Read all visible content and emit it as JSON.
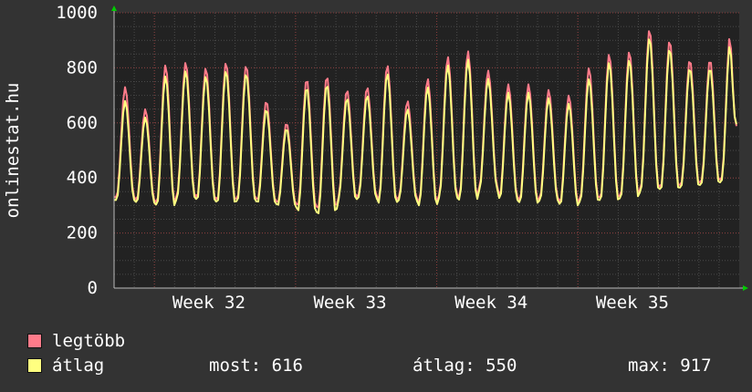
{
  "chart_data": {
    "type": "line",
    "ylabel": "onlinestat.hu",
    "ylim": [
      0,
      1000
    ],
    "y_ticks": [
      0,
      200,
      400,
      600,
      800,
      1000
    ],
    "x_tick_labels": [
      "Week 32",
      "Week 33",
      "Week 34",
      "Week 35"
    ],
    "grid": true,
    "series": [
      {
        "name": "legtöbb",
        "color": "#ff7b8a",
        "daily_peaks": [
          730,
          650,
          810,
          820,
          800,
          820,
          810,
          680,
          600,
          760,
          770,
          720,
          730,
          810,
          680,
          760,
          840,
          860,
          790,
          740,
          740,
          720,
          700,
          800,
          850,
          860,
          940,
          900,
          830,
          830,
          920
        ],
        "daily_troughs": [
          330,
          320,
          310,
          340,
          330,
          320,
          330,
          320,
          310,
          300,
          290,
          330,
          340,
          320,
          330,
          310,
          340,
          330,
          370,
          330,
          320,
          330,
          310,
          330,
          330,
          340,
          370,
          370,
          380,
          390,
          400
        ]
      },
      {
        "name": "átlag",
        "color": "#ffff80",
        "daily_peaks": [
          680,
          620,
          770,
          790,
          770,
          790,
          780,
          650,
          580,
          730,
          740,
          690,
          700,
          780,
          650,
          730,
          810,
          830,
          760,
          710,
          710,
          690,
          670,
          760,
          820,
          830,
          910,
          870,
          800,
          800,
          890
        ],
        "daily_troughs": [
          320,
          310,
          300,
          330,
          320,
          310,
          320,
          310,
          300,
          280,
          270,
          320,
          330,
          310,
          320,
          300,
          330,
          320,
          360,
          320,
          310,
          320,
          300,
          320,
          320,
          330,
          360,
          360,
          370,
          380,
          390
        ]
      }
    ],
    "last_values": [
      600,
      610
    ],
    "stats": {
      "most": "616",
      "atlag": "550",
      "max": "917"
    }
  },
  "legend": {
    "items": [
      {
        "label": "legtöbb",
        "color": "#ff7b8a"
      },
      {
        "label": "átlag",
        "color": "#ffff80"
      }
    ],
    "most_label": "most: 616",
    "atlag_label": "átlag: 550",
    "max_label": "max: 917"
  }
}
